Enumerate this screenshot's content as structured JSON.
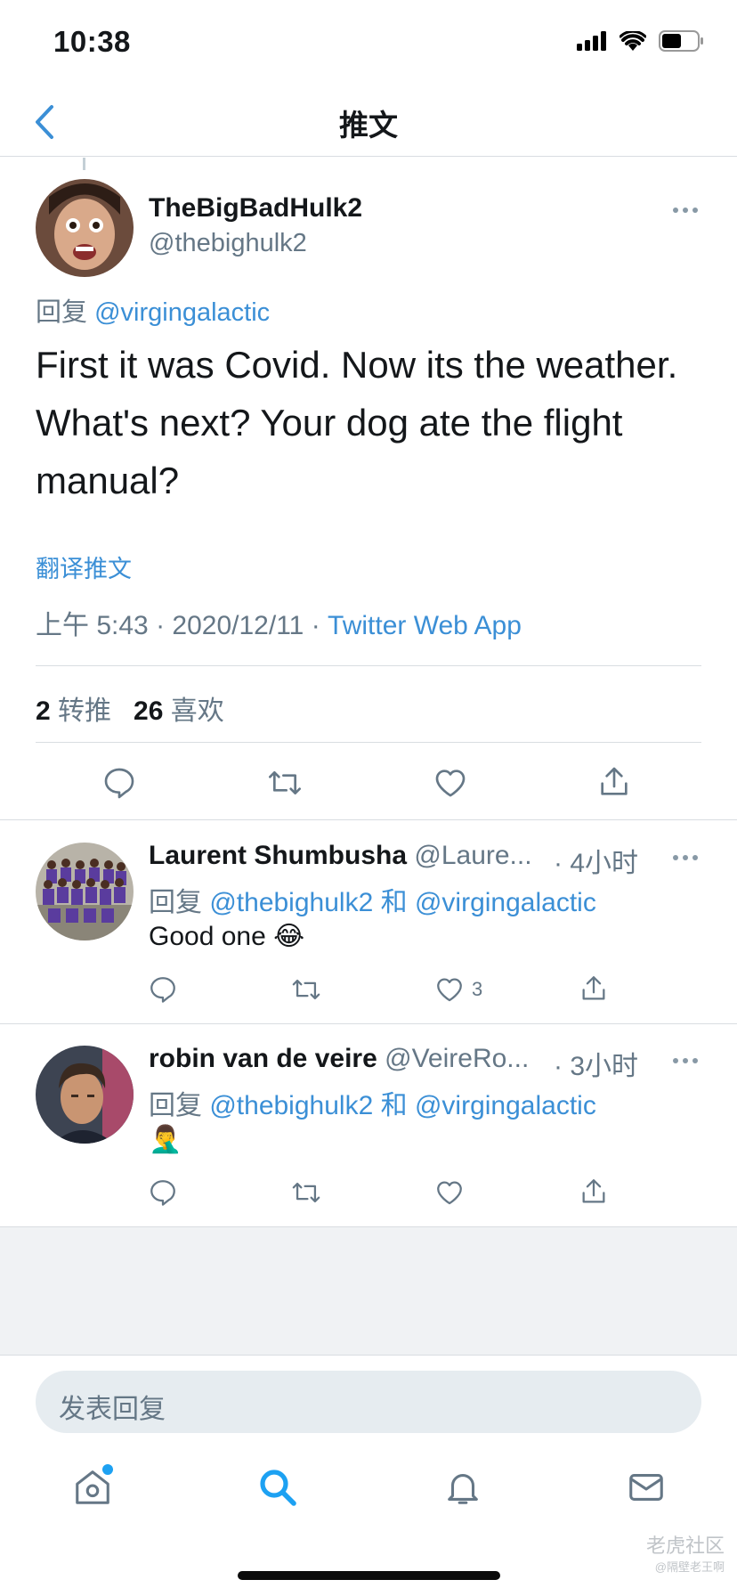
{
  "status_bar": {
    "time": "10:38",
    "icons": [
      "signal-icon",
      "wifi-icon",
      "battery-icon"
    ]
  },
  "nav": {
    "title": "推文",
    "back_icon": "chevron-left-icon"
  },
  "main_tweet": {
    "name": "TheBigBadHulk2",
    "handle": "@thebighulk2",
    "reply_prefix": "回复",
    "reply_to": "@virgingalactic",
    "text": "First it was Covid. Now its the weather. What's next? Your dog ate the flight manual?",
    "translate": "翻译推文",
    "time": "上午 5:43",
    "date": "2020/12/11",
    "sep": "·",
    "source": "Twitter Web App",
    "retweets": "2",
    "retweets_label": "转推",
    "likes": "26",
    "likes_label": "喜欢"
  },
  "replies": [
    {
      "name": "Laurent Shumbusha",
      "handle": "@Laure...",
      "time": "· 4小时",
      "reply_prefix": "回复",
      "mention1": "@thebighulk2",
      "and": "和",
      "mention2": "@virgingalactic",
      "text": "Good one 😂",
      "like_count": "3"
    },
    {
      "name": "robin van de veire",
      "handle": "@VeireRo...",
      "time": "· 3小时",
      "reply_prefix": "回复",
      "mention1": "@thebighulk2",
      "and": "和",
      "mention2": "@virgingalactic",
      "text": "🤦‍♂️",
      "like_count": ""
    }
  ],
  "compose": {
    "placeholder": "发表回复"
  },
  "tabs": [
    "home-icon",
    "search-icon",
    "bell-icon",
    "mail-icon"
  ],
  "watermark": {
    "line1": "老虎社区",
    "line2": "@隔壁老王啊"
  },
  "colors": {
    "accent": "#1da1f2",
    "link": "#3b8fd6",
    "secondary_text": "#657786"
  }
}
